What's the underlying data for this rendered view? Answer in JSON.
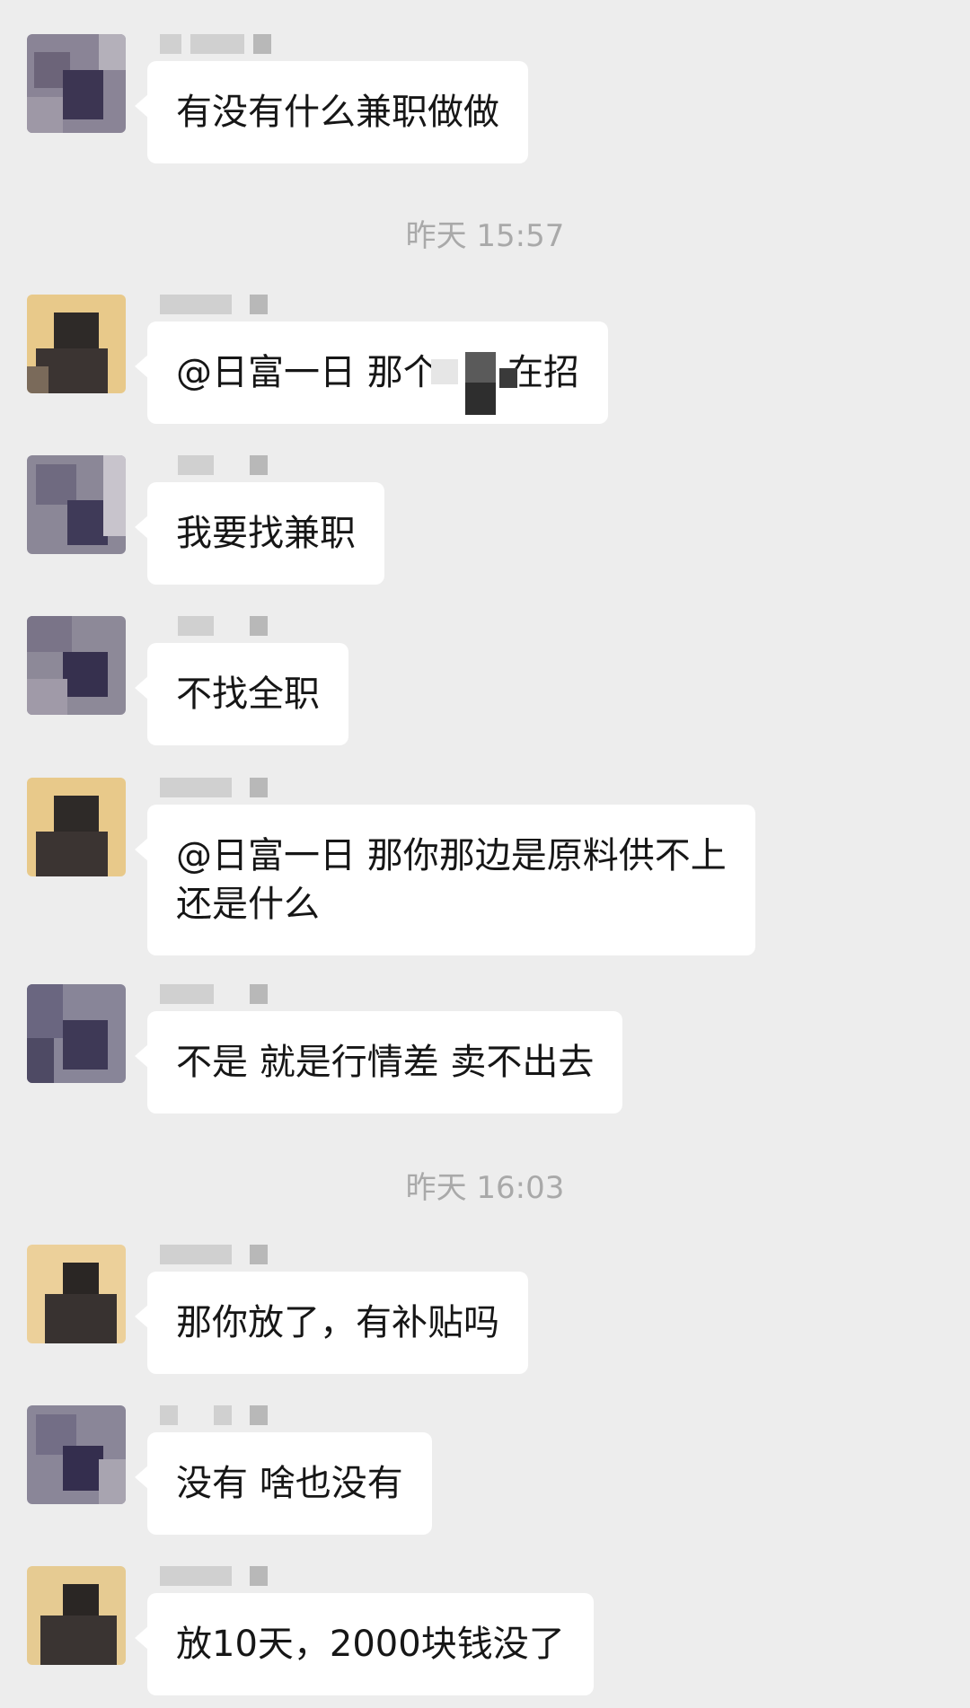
{
  "chat": {
    "messages": [
      {
        "text": "有没有什么兼职做做"
      },
      {
        "time": "昨天 15:57"
      },
      {
        "text": "@日富一日 那个      在招"
      },
      {
        "text": "我要找兼职"
      },
      {
        "text": "不找全职"
      },
      {
        "text": "@日富一日 那你那边是原料供不上\n还是什么"
      },
      {
        "text": "不是 就是行情差 卖不出去"
      },
      {
        "time": "昨天 16:03"
      },
      {
        "text": "那你放了，有补贴吗"
      },
      {
        "text": "没有 啥也没有"
      },
      {
        "text": "放10天，2000块钱没了"
      }
    ]
  },
  "colors": {
    "background": "#ededed",
    "bubble": "#ffffff",
    "text": "#161616",
    "timestamp": "#a9a9a9"
  }
}
